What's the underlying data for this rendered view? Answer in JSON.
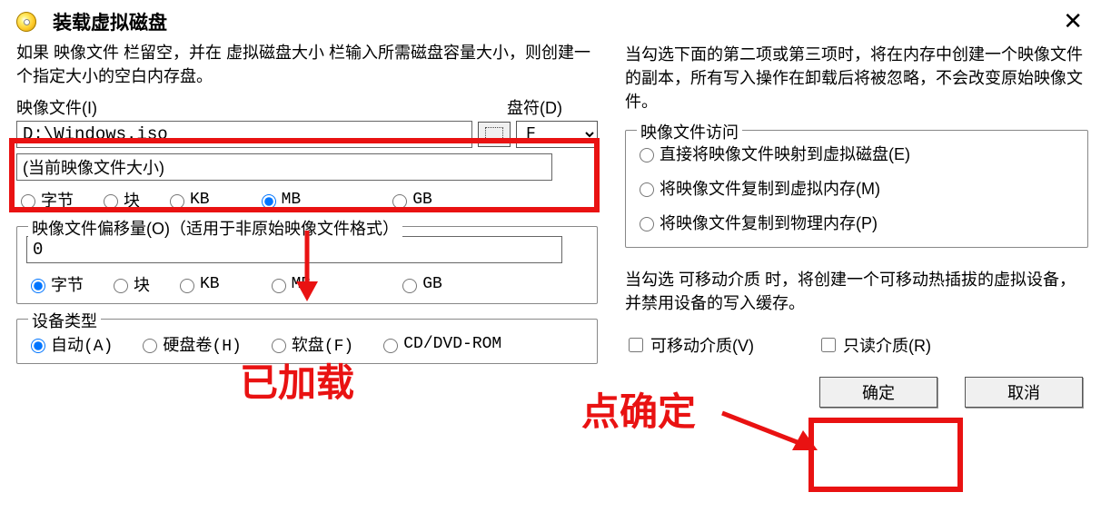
{
  "window": {
    "title": "装载虚拟磁盘",
    "close_label": "✕"
  },
  "left": {
    "intro": "如果 映像文件 栏留空，并在 虚拟磁盘大小 栏输入所需磁盘容量大小，则创建一个指定大小的空白内存盘。",
    "image_file_label": "映像文件(I)",
    "drive_label": "盘符(D)",
    "image_file_value": "D:\\Windows.iso",
    "drive_value": "F",
    "size_value": "(当前映像文件大小)",
    "unit_byte": "字节",
    "unit_block": "块",
    "unit_kb": "KB",
    "unit_mb": "MB",
    "unit_gb": "GB",
    "offset_label": "映像文件偏移量(O)（适用于非原始映像文件格式）",
    "offset_value": "0",
    "device_group_label": "设备类型",
    "device_auto": "自动(A)",
    "device_hd": "硬盘卷(H)",
    "device_floppy": "软盘(F)",
    "device_cd": "CD/DVD-ROM"
  },
  "right": {
    "intro": "当勾选下面的第二项或第三项时，将在内存中创建一个映像文件的副本，所有写入操作在卸载后将被忽略，不会改变原始映像文件。",
    "access_group_label": "映像文件访问",
    "access_direct": "直接将映像文件映射到虚拟磁盘(E)",
    "access_virtmem": "将映像文件复制到虚拟内存(M)",
    "access_physmem": "将映像文件复制到物理内存(P)",
    "removable_intro": "当勾选 可移动介质 时，将创建一个可移动热插拔的虚拟设备，并禁用设备的写入缓存。",
    "removable_check": "可移动介质(V)",
    "readonly_check": "只读介质(R)",
    "ok_label": "确定",
    "cancel_label": "取消"
  },
  "annotations": {
    "loaded": "已加载",
    "click_ok": "点确定"
  }
}
